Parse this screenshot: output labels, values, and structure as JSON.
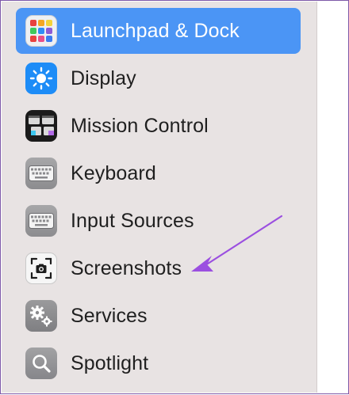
{
  "sidebar": {
    "items": [
      {
        "label": "Launchpad & Dock",
        "icon": "launchpad-icon",
        "selected": true
      },
      {
        "label": "Display",
        "icon": "display-brightness-icon",
        "selected": false
      },
      {
        "label": "Mission Control",
        "icon": "mission-control-icon",
        "selected": false
      },
      {
        "label": "Keyboard",
        "icon": "keyboard-icon",
        "selected": false
      },
      {
        "label": "Input Sources",
        "icon": "keyboard-icon",
        "selected": false
      },
      {
        "label": "Screenshots",
        "icon": "screenshot-camera-icon",
        "selected": false
      },
      {
        "label": "Services",
        "icon": "gears-icon",
        "selected": false
      },
      {
        "label": "Spotlight",
        "icon": "magnifier-icon",
        "selected": false
      }
    ]
  },
  "annotation": {
    "icon": "pointer-arrow-icon",
    "color": "#9b4fe0"
  },
  "colors": {
    "selection": "#4b95f5",
    "sidebar_bg": "#e8e3e3"
  }
}
